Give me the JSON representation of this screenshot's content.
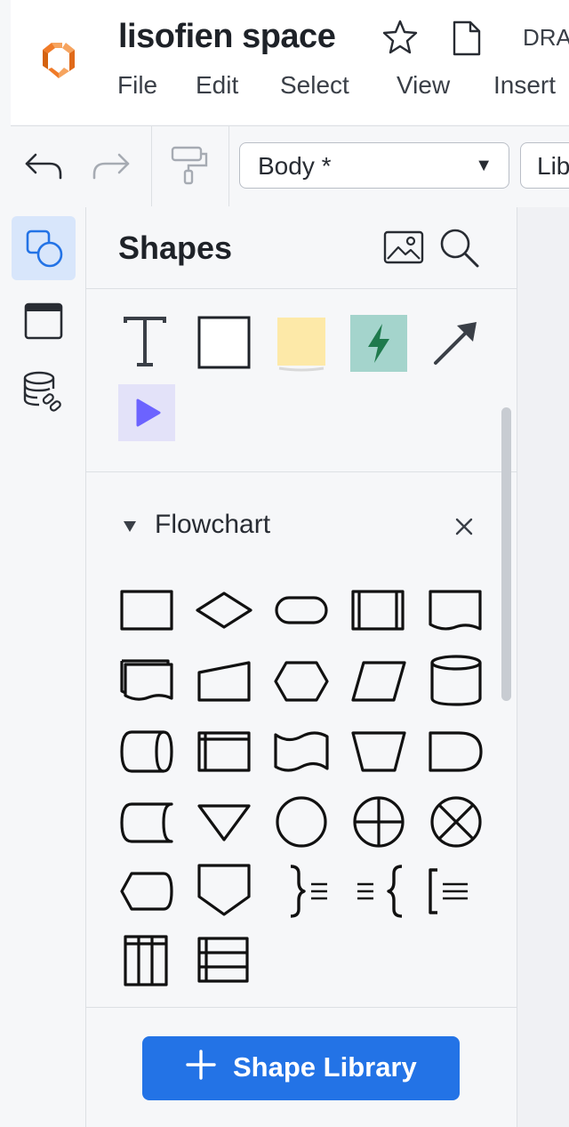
{
  "header": {
    "doc_title": "lisofien space",
    "status_text": "DRA",
    "menu": [
      "File",
      "Edit",
      "Select",
      "View",
      "Insert"
    ]
  },
  "toolbar": {
    "style_select_value": "Body *",
    "font_select_value": "Lib"
  },
  "panel": {
    "title": "Shapes",
    "library_section": "Flowchart",
    "shape_library_button": "Shape Library"
  },
  "colors": {
    "accent": "#2373e6",
    "note_yellow": "#fde9a8",
    "action_green": "#a4d4cc",
    "video_purple": "#e3e2f9",
    "logo_orange": "#f07b28"
  },
  "icons": {
    "rail": [
      "shapes-icon",
      "page-frame-icon",
      "data-linking-icon"
    ],
    "quick_shapes": [
      "text-shape-icon",
      "rectangle-shape-icon",
      "sticky-note-icon",
      "action-bolt-icon",
      "arrow-line-icon",
      "video-play-icon"
    ],
    "flowchart_shapes": [
      "process-icon",
      "decision-icon",
      "terminator-icon",
      "predefined-process-icon",
      "document-icon",
      "multiple-documents-icon",
      "manual-input-icon",
      "preparation-icon",
      "data-icon",
      "database-icon",
      "direct-access-storage-icon",
      "internal-storage-icon",
      "paper-tape-icon",
      "manual-operation-icon",
      "delay-icon",
      "stored-data-icon",
      "merge-icon",
      "connector-icon",
      "or-icon",
      "summing-junction-icon",
      "display-icon",
      "off-page-link-icon",
      "brace-note-right-icon",
      "brace-note-left-icon",
      "annotation-icon",
      "swimlane-vertical-icon",
      "swimlane-horizontal-icon"
    ]
  }
}
